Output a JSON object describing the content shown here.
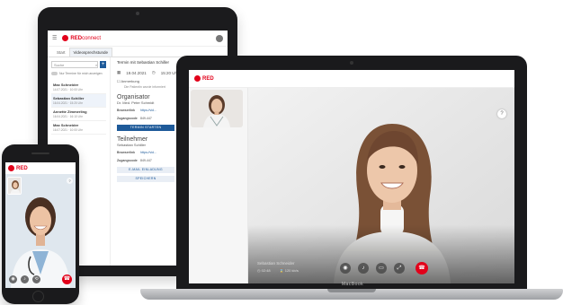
{
  "brand": {
    "logo_red": "RED",
    "logo_sub": "connect",
    "accent": "#e2001a",
    "primary": "#1e5a99"
  },
  "tablet": {
    "menu_icon": "hamburger-icon",
    "tabs": [
      {
        "label": "Start"
      },
      {
        "label": "Videosprechstunde"
      }
    ],
    "search_placeholder": "Suche",
    "add_label": "+",
    "toggle_label": "Nur Termine für mich anzeigen",
    "appointments": [
      {
        "name": "Max Schneider",
        "date": "14.07.2021 · 10:00 Uhr"
      },
      {
        "name": "Sebastian Schiller",
        "date": "16.04.2021 · 15:20 Uhr"
      },
      {
        "name": "Annette Zimmerling",
        "date": "16.04.2021 · 16:10 Uhr"
      },
      {
        "name": "Max Schneider",
        "date": "16.07.2021 · 10:00 Uhr"
      }
    ],
    "detail": {
      "title": "Termin mit Sebastian Schiller",
      "date": "19.04.2021",
      "time": "15:20 Uhr",
      "note_label": "Anmerkung",
      "note_text": "Die Patientin wurde informiert",
      "organizer_heading": "Organisator",
      "organizer_name": "Dr. Med. Peter Schmidt",
      "browser_link_label": "Browserlink",
      "browser_link_value": "https://vid...",
      "access_code_label": "Zugangscode",
      "access_code_value": "849-447",
      "start_button": "TERMIN STARTEN",
      "participant_heading": "Teilnehmer",
      "participant_name": "Sebastian Schiller",
      "email_button": "E-MAIL EINLADUNG",
      "save_button": "SPEICHERN"
    }
  },
  "laptop": {
    "help_icon_label": "?",
    "caller_name": "Sebastian Schneider",
    "duration": "02:48",
    "bandwidth": "120 kb/s",
    "brand_label": "MacBook"
  },
  "phone": {
    "help_icon_label": "?"
  }
}
